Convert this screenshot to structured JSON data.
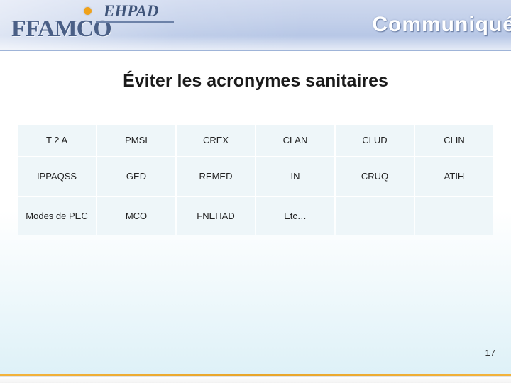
{
  "header": {
    "logo_primary": "FFAMCO",
    "logo_secondary": "EHPAD",
    "banner_word": "Communiqué"
  },
  "slide": {
    "title": "Éviter les acronymes sanitaires",
    "page_number": "17"
  },
  "table": {
    "rows": [
      [
        "T 2 A",
        "PMSI",
        "CREX",
        "CLAN",
        "CLUD",
        "CLIN"
      ],
      [
        "IPPAQSS",
        "GED",
        "REMED",
        "IN",
        "CRUQ",
        "ATIH"
      ],
      [
        "Modes de PEC",
        "MCO",
        "FNEHAD",
        "Etc…",
        "",
        ""
      ]
    ]
  }
}
